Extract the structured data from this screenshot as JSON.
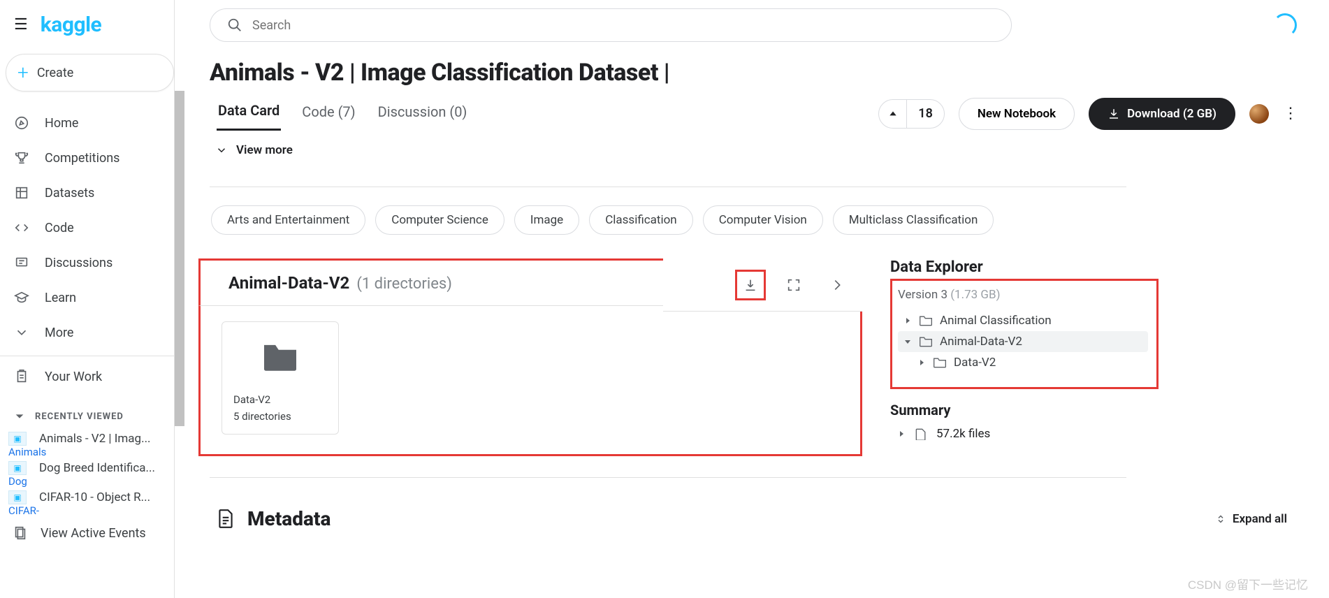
{
  "brand": "kaggle",
  "search": {
    "placeholder": "Search"
  },
  "create_label": "Create",
  "nav": {
    "home": "Home",
    "competitions": "Competitions",
    "datasets": "Datasets",
    "code": "Code",
    "discussions": "Discussions",
    "learn": "Learn",
    "more": "More",
    "your_work": "Your Work"
  },
  "recent": {
    "heading": "RECENTLY VIEWED",
    "items": [
      {
        "title": "Animals - V2 | Imag...",
        "sub": "Animals"
      },
      {
        "title": "Dog Breed Identifica...",
        "sub": "Dog"
      },
      {
        "title": "CIFAR-10 - Object R...",
        "sub": "CIFAR-"
      }
    ],
    "view_events": "View Active Events"
  },
  "page": {
    "title": "Animals - V2 | Image Classification Dataset |",
    "tabs": {
      "data_card": "Data Card",
      "code": "Code (7)",
      "discussion": "Discussion (0)"
    },
    "votes": "18",
    "new_notebook": "New Notebook",
    "download": "Download (2 GB)",
    "view_more": "View more"
  },
  "tags": [
    "Arts and Entertainment",
    "Computer Science",
    "Image",
    "Classification",
    "Computer Vision",
    "Multiclass Classification"
  ],
  "folder_panel": {
    "title": "Animal-Data-V2",
    "subtitle": "(1 directories)",
    "card": {
      "name": "Data-V2",
      "dirs": "5 directories"
    }
  },
  "explorer": {
    "title": "Data Explorer",
    "version": "Version 3",
    "size": "(1.73 GB)",
    "tree": {
      "n1": "Animal Classification",
      "n2": "Animal-Data-V2",
      "n3": "Data-V2"
    },
    "summary_title": "Summary",
    "summary_files": "57.2k files"
  },
  "metadata": {
    "title": "Metadata",
    "expand": "Expand all"
  },
  "watermark": "CSDN @留下一些记忆"
}
